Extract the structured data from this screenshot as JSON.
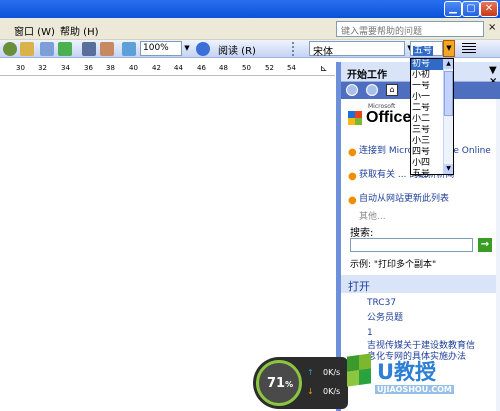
{
  "menubar": {
    "items": [
      "窗口 (W)",
      "帮助 (H)"
    ],
    "help_placeholder": "键入需要帮助的问题",
    "help_close": "×"
  },
  "toolbar": {
    "zoom": "100%",
    "read_label": "阅读 (R)",
    "font_name": "宋体",
    "font_size": "五号"
  },
  "ruler": {
    "ticks": [
      "30",
      "32",
      "34",
      "36",
      "38",
      "40",
      "42",
      "44",
      "46",
      "48",
      "50",
      "52",
      "54"
    ]
  },
  "font_size_list": {
    "options": [
      "初号",
      "小初",
      "一号",
      "小一",
      "二号",
      "小二",
      "三号",
      "小三",
      "四号",
      "小四",
      "五号"
    ],
    "selected": "初号"
  },
  "taskpane": {
    "title": "开始工作",
    "close": "▼ ×",
    "office_ms": "Microsoft",
    "office_name": "Office",
    "links": [
      "连接到 Microsoft Office Online",
      "获取有关 ... 的最新新闻",
      "自动从网站更新此列表"
    ],
    "more": "其他...",
    "search_label": "搜索:",
    "search_go": "→",
    "example": "示例:  \"打印多个副本\"",
    "open_title": "打开",
    "files": [
      "TRC37",
      "公务员题",
      "1",
      "吉视传媒关于建设数教育信",
      "息化专网的具体实施办法"
    ]
  },
  "speed_widget": {
    "percent": "71",
    "percent_unit": "%",
    "up": "0K/s",
    "down": "0K/s"
  },
  "watermark": {
    "brand": "U教授",
    "url": "UJIAOSHOU.COM"
  }
}
